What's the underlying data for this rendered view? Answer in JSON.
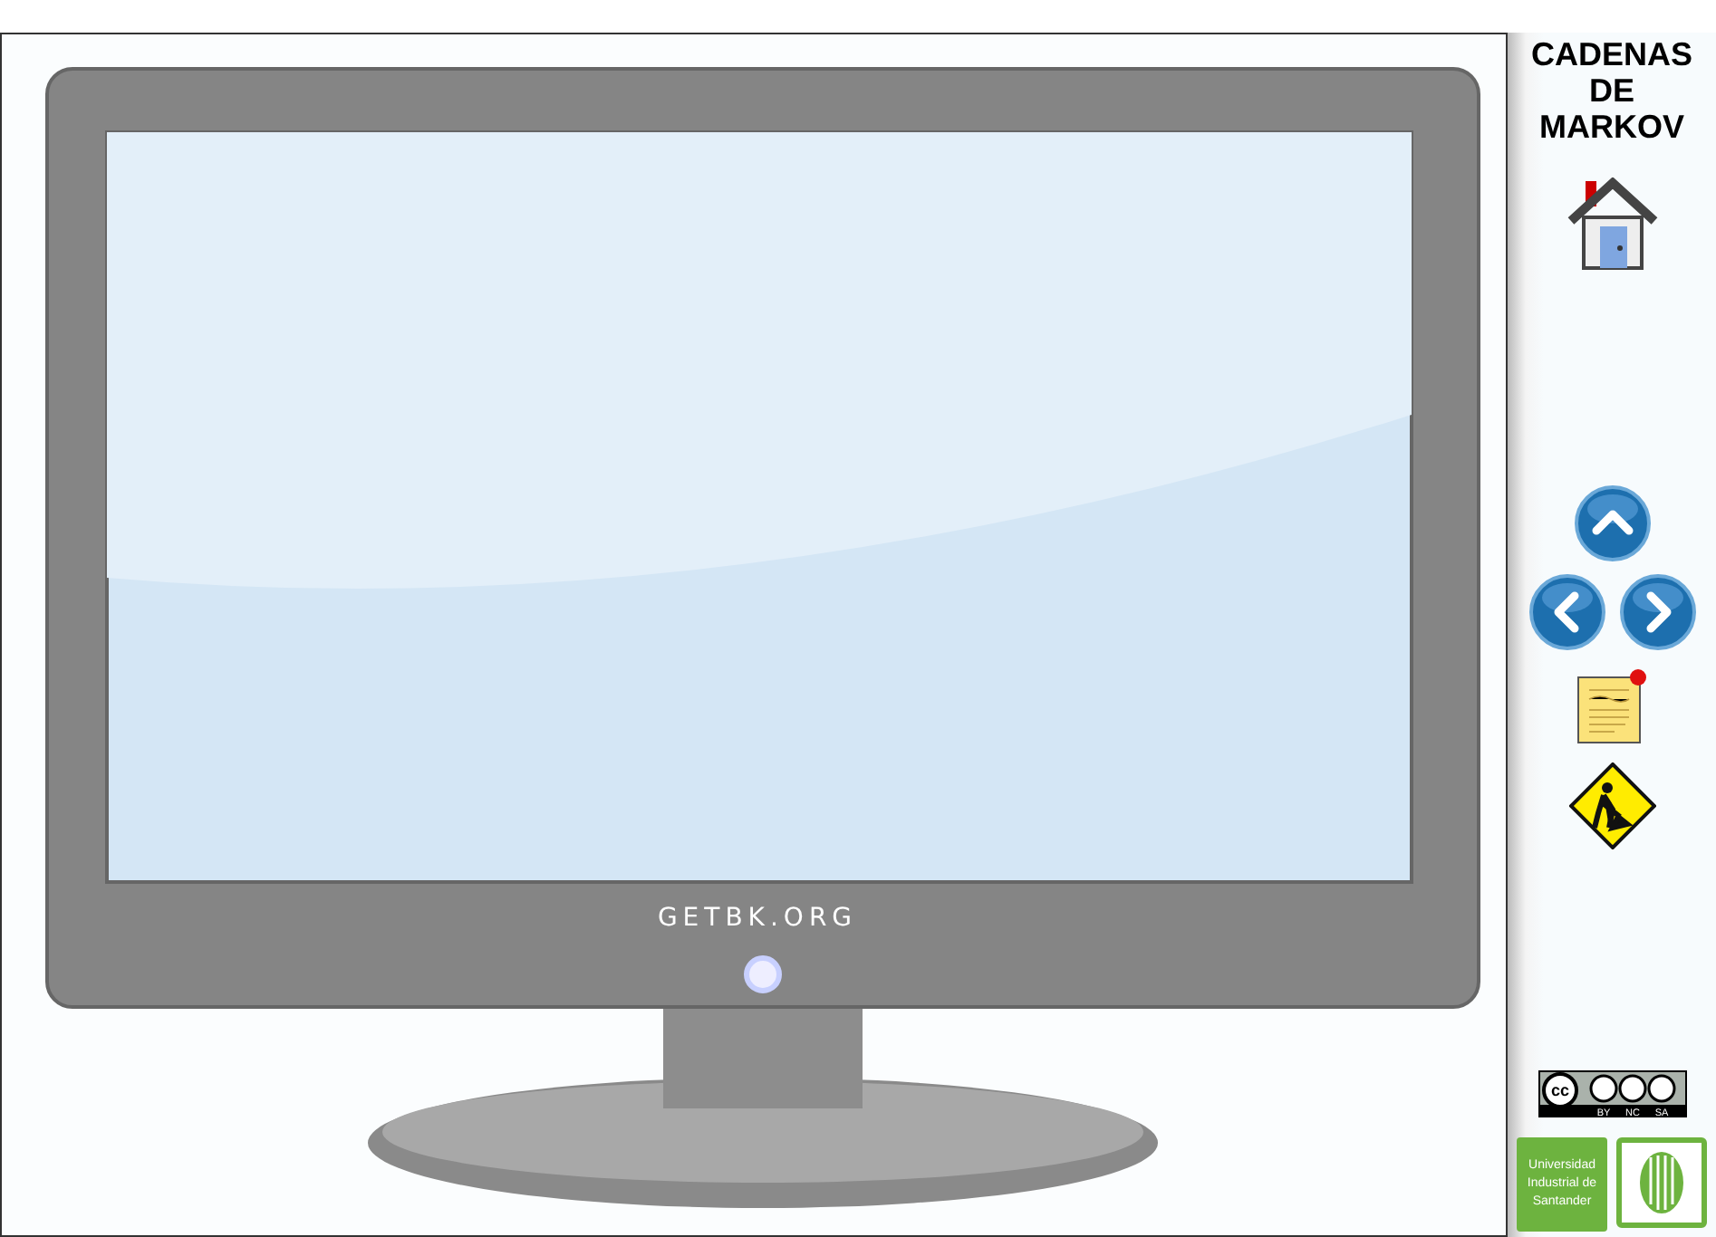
{
  "title": "CADENAS DE MARKOV",
  "monitor": {
    "brand": "GETBK.ORG"
  },
  "license": {
    "badge": "cc",
    "terms": [
      "BY",
      "NC",
      "SA"
    ]
  },
  "university": {
    "name": "Universidad Industrial de Santander"
  }
}
